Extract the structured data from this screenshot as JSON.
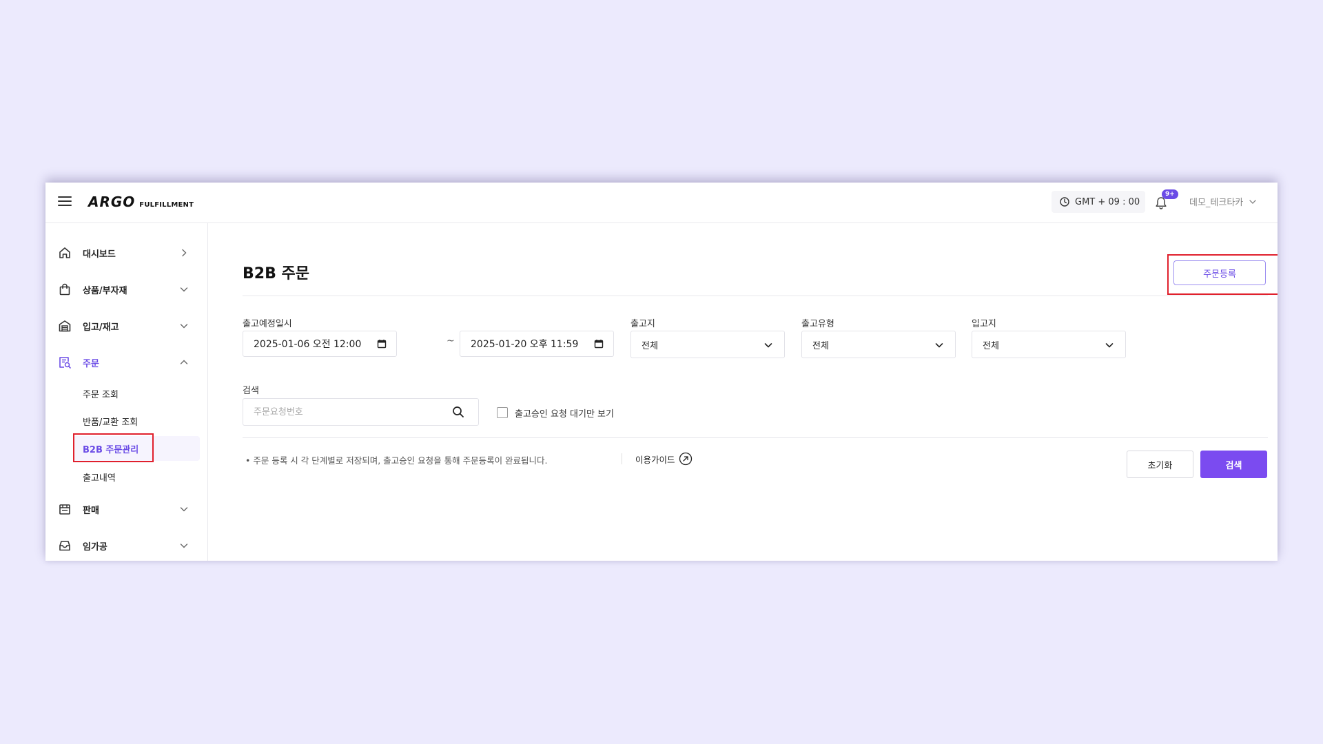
{
  "header": {
    "logo_main": "ARGO",
    "logo_sub": "FULFILLMENT",
    "timezone": "GMT + 09 : 00",
    "notification_badge": "9+",
    "user_name": "데모_테크타카"
  },
  "sidebar": {
    "items": [
      {
        "label": "대시보드",
        "icon": "home-icon",
        "chevron": "right"
      },
      {
        "label": "상품/부자재",
        "icon": "shopping-bag-icon",
        "chevron": "down"
      },
      {
        "label": "입고/재고",
        "icon": "warehouse-icon",
        "chevron": "down"
      },
      {
        "label": "주문",
        "icon": "order-search-icon",
        "chevron": "up",
        "active": true
      },
      {
        "label": "판매",
        "icon": "store-icon",
        "chevron": "down"
      },
      {
        "label": "임가공",
        "icon": "inbox-icon",
        "chevron": "down"
      }
    ],
    "sub_items": [
      {
        "label": "주문 조회"
      },
      {
        "label": "반품/교환 조회"
      },
      {
        "label": "B2B 주문관리",
        "active": true
      },
      {
        "label": "출고내역"
      }
    ]
  },
  "main": {
    "title": "B2B 주문",
    "register_button": "주문등록",
    "filters": {
      "date_label": "출고예정일시",
      "date_from": "2025-01-06 오전 12:00",
      "date_to": "2025-01-20 오후 11:59",
      "date_separator": "~",
      "origin_label": "출고지",
      "origin_value": "전체",
      "type_label": "출고유형",
      "type_value": "전체",
      "destination_label": "입고지",
      "destination_value": "전체",
      "search_label": "검색",
      "search_placeholder": "주문요청번호",
      "search_value": "",
      "checkbox_label": "출고승인 요청 대기만 보기",
      "checkbox_checked": false
    },
    "notice": "• 주문 등록 시 각 단계별로 저장되며, 출고승인 요청을 통해 주문등록이 완료됩니다.",
    "guide_link": "이용가이드",
    "reset_button": "초기화",
    "search_button": "검색"
  },
  "colors": {
    "accent": "#7b4bf0",
    "highlight_box": "#e0202c",
    "background": "#eceafd"
  }
}
